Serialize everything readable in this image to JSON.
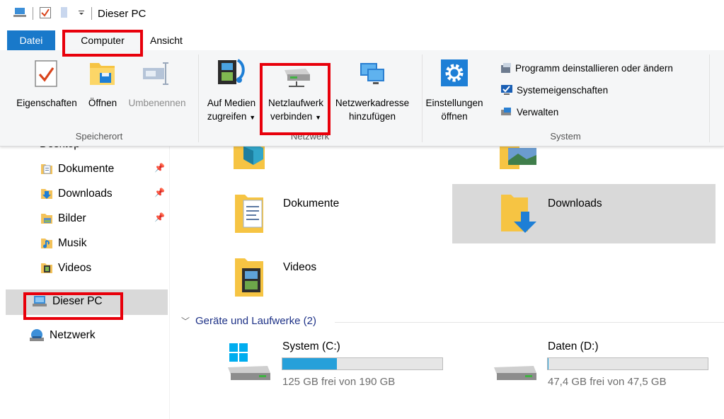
{
  "window": {
    "title": "Dieser PC"
  },
  "tabs": {
    "file": "Datei",
    "computer": "Computer",
    "view": "Ansicht"
  },
  "ribbon": {
    "location": {
      "label": "Speicherort",
      "properties": "Eigenschaften",
      "open": "Öffnen",
      "rename": "Umbenennen"
    },
    "network": {
      "label": "Netzwerk",
      "media_line1": "Auf Medien",
      "media_line2": "zugreifen",
      "map_line1": "Netzlaufwerk",
      "map_line2": "verbinden",
      "addr_line1": "Netzwerkadresse",
      "addr_line2": "hinzufügen"
    },
    "system": {
      "label": "System",
      "settings_line1": "Einstellungen",
      "settings_line2": "öffnen",
      "uninstall": "Programm deinstallieren oder ändern",
      "sysprops": "Systemeigenschaften",
      "manage": "Verwalten"
    }
  },
  "nav": {
    "desktop": "Desktop",
    "documents": "Dokumente",
    "downloads": "Downloads",
    "pictures": "Bilder",
    "music": "Musik",
    "videos": "Videos",
    "this_pc": "Dieser PC",
    "network": "Netzwerk"
  },
  "folders": {
    "documents": "Dokumente",
    "downloads": "Downloads",
    "videos": "Videos"
  },
  "devices": {
    "header": "Geräte und Laufwerke (2)",
    "c_name": "System (C:)",
    "c_free": "125 GB frei von 190 GB",
    "c_used_fraction": 0.342,
    "d_name": "Daten (D:)",
    "d_free": "47,4 GB frei von 47,5 GB",
    "d_used_fraction": 0.002
  },
  "colors": {
    "accent": "#1979ca",
    "highlight": "#e8000b",
    "selection": "#d9d9d9",
    "drive_fill": "#26a0da"
  }
}
